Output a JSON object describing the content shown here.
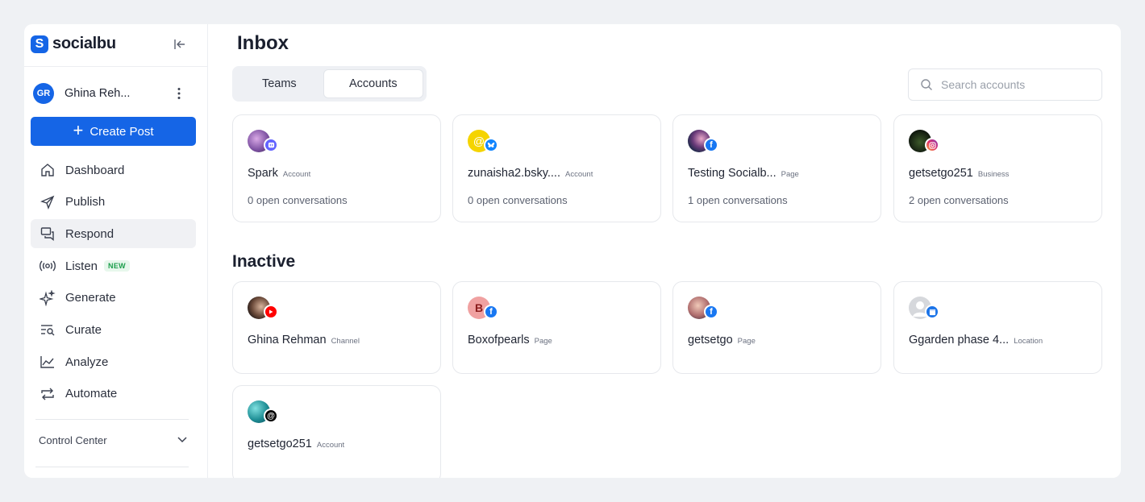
{
  "brand": {
    "name": "socialbu",
    "logo_letter": "S",
    "color": "#1565e6"
  },
  "user": {
    "initials": "GR",
    "name": "Ghina Reh..."
  },
  "sidebar": {
    "create_label": "Create Post",
    "items": [
      {
        "label": "Dashboard",
        "icon": "home-icon"
      },
      {
        "label": "Publish",
        "icon": "send-icon"
      },
      {
        "label": "Respond",
        "icon": "chat-icon",
        "active": true
      },
      {
        "label": "Listen",
        "icon": "broadcast-icon",
        "badge": "NEW"
      },
      {
        "label": "Generate",
        "icon": "sparkle-icon"
      },
      {
        "label": "Curate",
        "icon": "search-list-icon"
      },
      {
        "label": "Analyze",
        "icon": "chart-line-icon"
      },
      {
        "label": "Automate",
        "icon": "repeat-icon"
      }
    ],
    "control_center": "Control Center"
  },
  "main": {
    "title": "Inbox",
    "tabs": [
      {
        "label": "Teams"
      },
      {
        "label": "Accounts",
        "active": true
      }
    ],
    "search_placeholder": "Search accounts",
    "active_accounts": [
      {
        "name": "Spark",
        "kind": "Account",
        "conversations": "0 open conversations",
        "network": "mastodon",
        "network_color": "#6364ff"
      },
      {
        "name": "zunaisha2.bsky....",
        "kind": "Account",
        "conversations": "0 open conversations",
        "network": "bluesky",
        "network_color": "#1185fe"
      },
      {
        "name": "Testing Socialb...",
        "kind": "Page",
        "conversations": "1 open conversations",
        "network": "facebook",
        "network_color": "#1877f2"
      },
      {
        "name": "getsetgo251",
        "kind": "Business",
        "conversations": "2 open conversations",
        "network": "instagram",
        "network_color": "#e1306c"
      }
    ],
    "inactive_title": "Inactive",
    "inactive_accounts": [
      {
        "name": "Ghina Rehman",
        "kind": "Channel",
        "network": "youtube",
        "network_color": "#ff0000"
      },
      {
        "name": "Boxofpearls",
        "kind": "Page",
        "network": "facebook",
        "network_color": "#1877f2",
        "avatar_letter": "B"
      },
      {
        "name": "getsetgo",
        "kind": "Page",
        "network": "facebook",
        "network_color": "#1877f2"
      },
      {
        "name": "Ggarden phase 4...",
        "kind": "Location",
        "network": "google-business",
        "network_color": "#1a73e8"
      },
      {
        "name": "getsetgo251",
        "kind": "Account",
        "network": "threads",
        "network_color": "#000000"
      }
    ]
  }
}
